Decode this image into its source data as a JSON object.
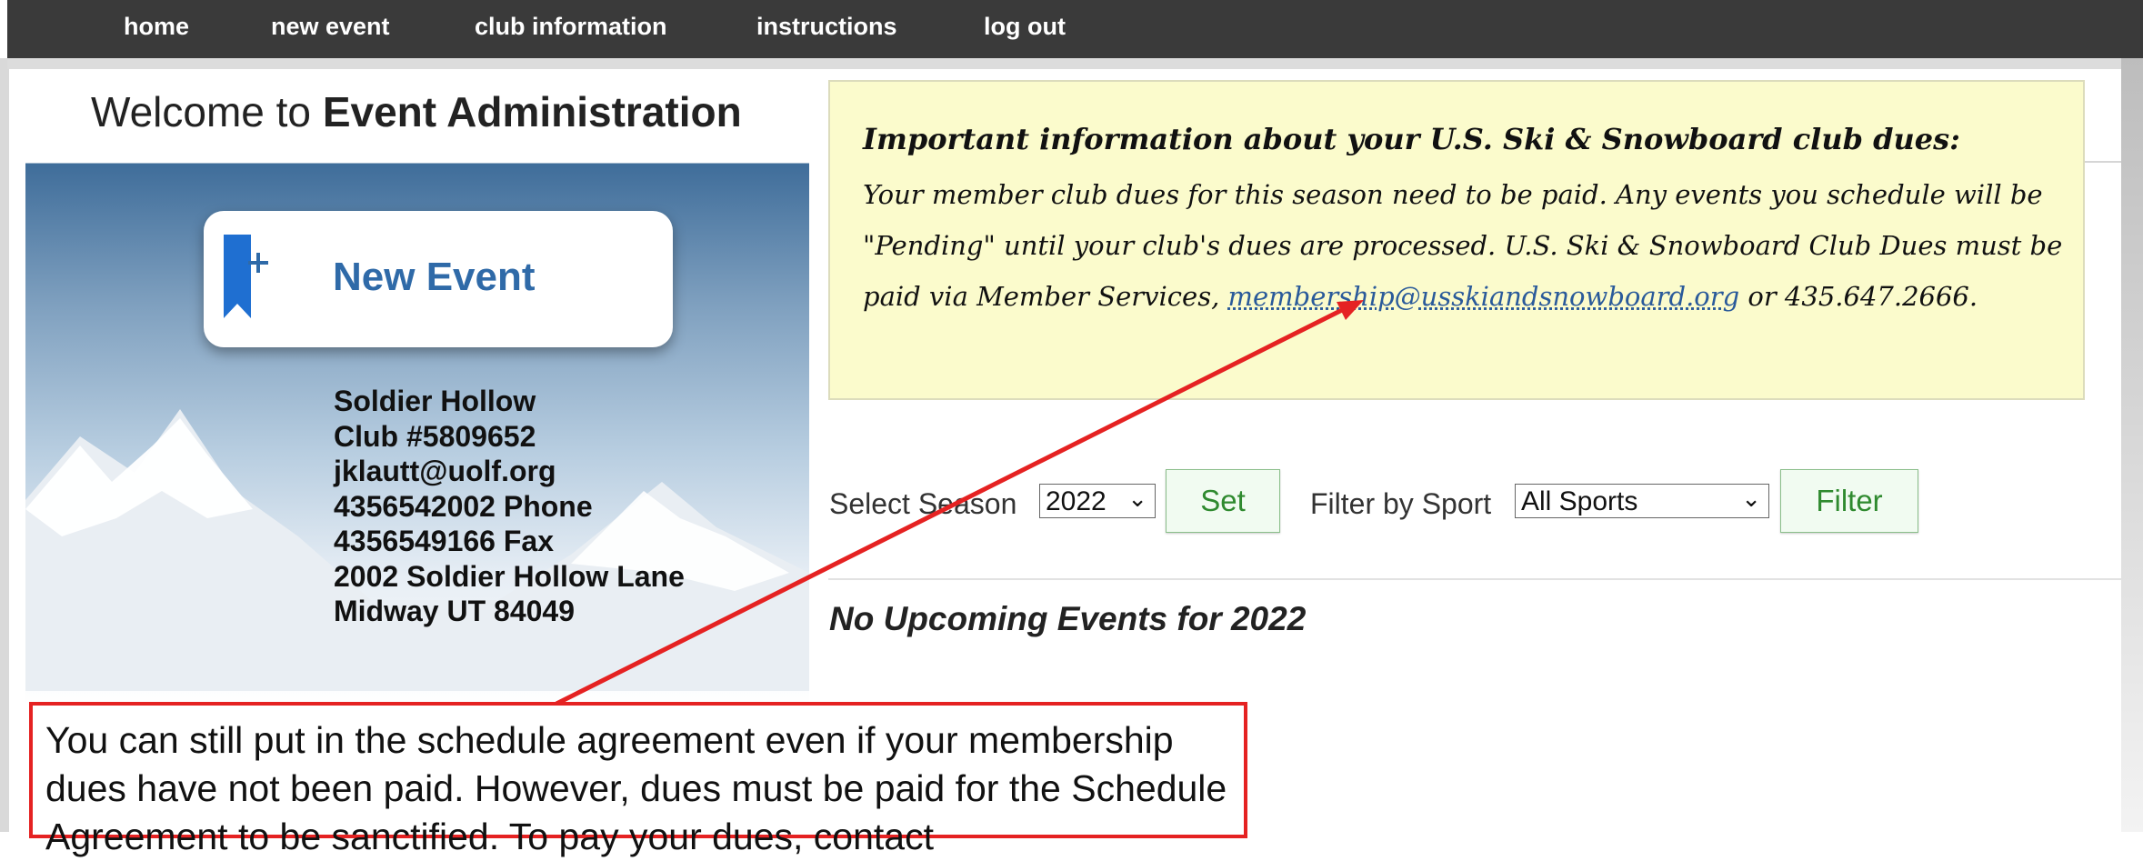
{
  "nav": {
    "items": [
      "home",
      "new event",
      "club information",
      "instructions",
      "log out"
    ]
  },
  "welcome": {
    "prefix": "Welcome to",
    "bold": "Event Administration"
  },
  "new_event_button": {
    "label": "New Event",
    "icon": "bookmark-plus-icon"
  },
  "club": {
    "name": "Soldier Hollow",
    "number": "Club #5809652",
    "email": "jklautt@uolf.org",
    "phone": "4356542002 Phone",
    "fax": "4356549166 Fax",
    "address1": "2002 Soldier Hollow Lane",
    "address2": "Midway  UT  84049"
  },
  "notice": {
    "title": "Important information about your U.S. Ski & Snowboard club dues:",
    "body_before_link": "Your member club dues for this season need to be paid. Any events you schedule will be \"Pending\" until your club's dues are processed. U.S. Ski & Snowboard Club Dues must be paid via Member Services,",
    "link": "membership@usskiandsnowboard.org",
    "body_after_link": "or 435.647.2666."
  },
  "controls": {
    "season_label": "Select Season",
    "season_value": "2022",
    "set_button": "Set",
    "sport_label": "Filter by Sport",
    "sport_value": "All Sports",
    "filter_button": "Filter"
  },
  "events": {
    "empty_message": "No Upcoming Events for 2022"
  },
  "callout": {
    "text": "You can still put in the schedule agreement even if your membership dues have not been paid.  However, dues must be paid for the Schedule Agreement to be sanctified. To pay your dues, contact"
  },
  "colors": {
    "nav_bg": "#3a3a3a",
    "notice_bg": "#fbfbcc",
    "callout_border": "#e52222",
    "button_text": "#2f8a2f",
    "link": "#2a5a9a"
  }
}
